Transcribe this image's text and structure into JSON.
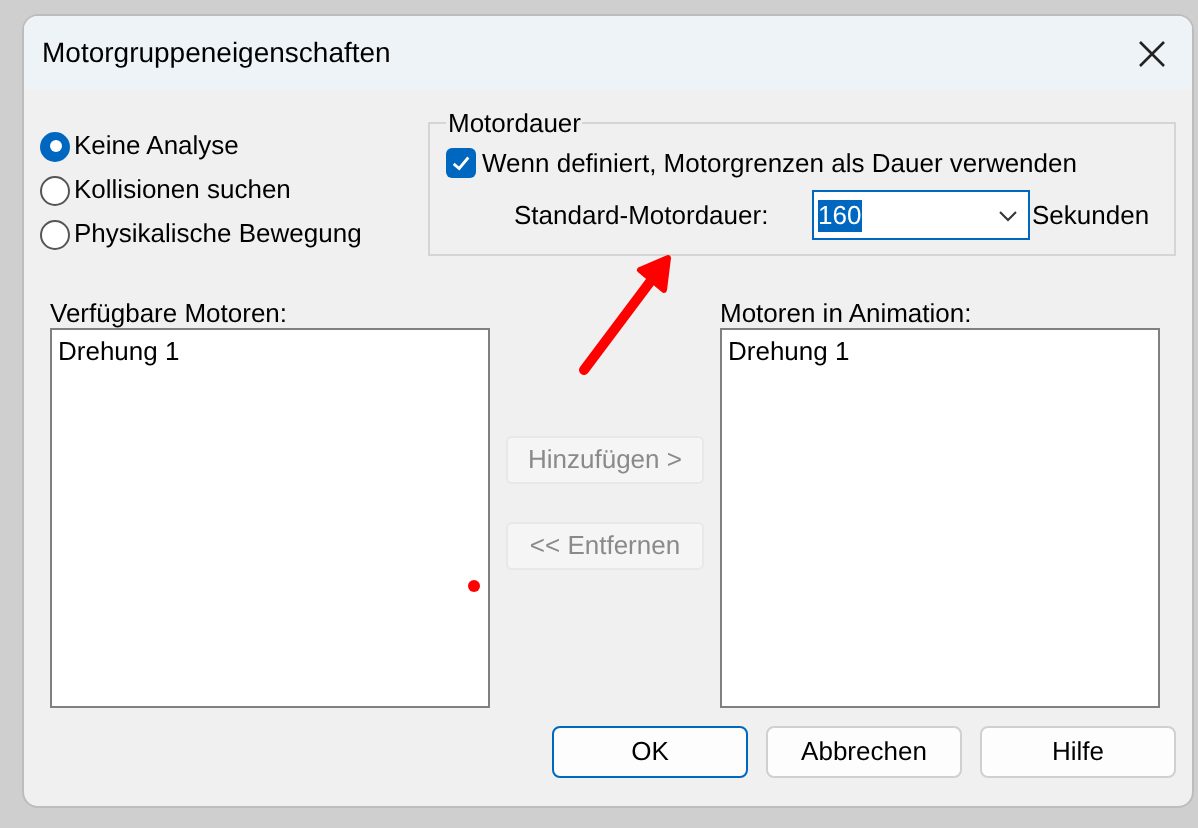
{
  "window": {
    "title": "Motorgruppeneigenschaften"
  },
  "analysis_options": [
    {
      "label": "Keine Analyse",
      "selected": true
    },
    {
      "label": "Kollisionen suchen",
      "selected": false
    },
    {
      "label": "Physikalische Bewegung",
      "selected": false
    }
  ],
  "motor_duration": {
    "title": "Motordauer",
    "use_limits": {
      "label": "Wenn definiert, Motorgrenzen als Dauer verwenden",
      "checked": true
    },
    "default_label": "Standard-Motordauer:",
    "default_value": "160",
    "unit": "Sekunden"
  },
  "available": {
    "label": "Verfügbare Motoren:",
    "items": [
      "Drehung 1"
    ]
  },
  "in_animation": {
    "label": "Motoren in Animation:",
    "items": [
      "Drehung 1"
    ]
  },
  "move_buttons": [
    {
      "label": "Hinzufügen >",
      "disabled": true
    },
    {
      "label": "<< Entfernen",
      "disabled": true
    }
  ],
  "buttons": [
    {
      "label": "OK",
      "default": true
    },
    {
      "label": "Abbrechen",
      "default": false
    },
    {
      "label": "Hilfe",
      "default": false
    }
  ]
}
